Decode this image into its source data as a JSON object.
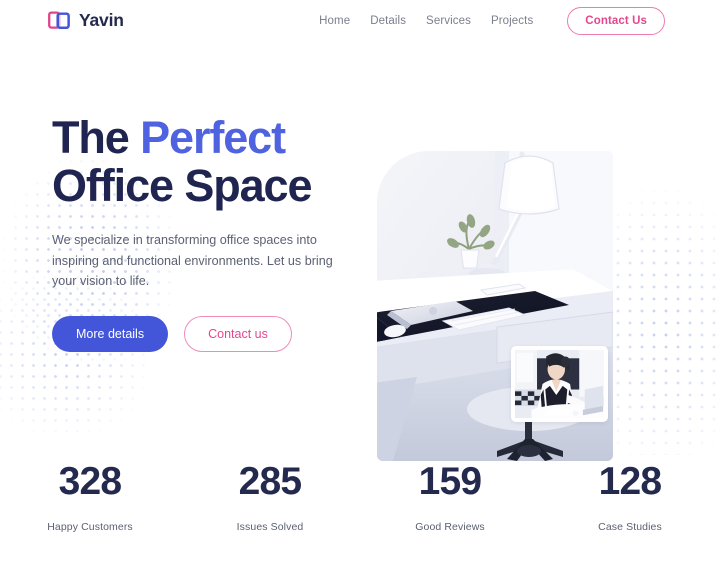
{
  "header": {
    "brand": {
      "name": "Yavin",
      "logo_icon": "open-book-icon",
      "logo_left_color": "#e0458a",
      "logo_right_color": "#4355d8"
    },
    "nav_links": [
      {
        "label": "Home"
      },
      {
        "label": "Details"
      },
      {
        "label": "Services"
      },
      {
        "label": "Projects"
      }
    ],
    "cta": {
      "label": "Contact Us",
      "color": "#e2488e"
    }
  },
  "hero": {
    "title_part1": "The ",
    "title_accent": "Perfect",
    "title_part2": "Office Space",
    "accent_color": "#4f62e0",
    "heading_color": "#1f2450",
    "paragraph": "We specialize in transforming office spaces into inspiring and functional environments. Let us bring your vision to life.",
    "primary_button": {
      "label": "More details",
      "color": "#4355d8"
    },
    "secondary_button": {
      "label": "Contact us",
      "color": "#e2488e"
    },
    "photo_alt": "white minimalist office desk with lamp laptop keyboard and plant",
    "inset_alt": "woman in white blouse working at a laptop"
  },
  "stats": [
    {
      "value": "328",
      "label": "Happy Customers"
    },
    {
      "value": "285",
      "label": "Issues Solved"
    },
    {
      "value": "159",
      "label": "Good Reviews"
    },
    {
      "value": "128",
      "label": "Case Studies"
    }
  ]
}
